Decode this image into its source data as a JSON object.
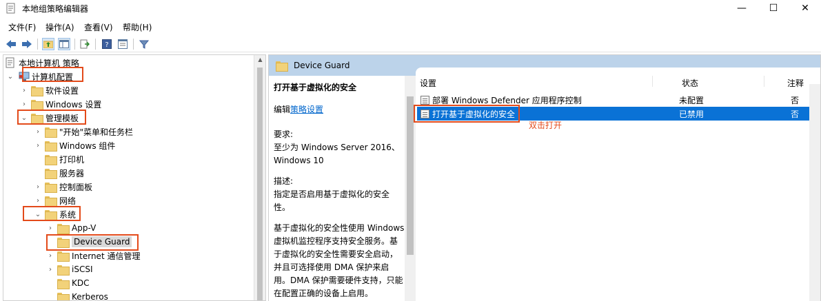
{
  "window": {
    "title": "本地组策略编辑器",
    "min": "—",
    "max": "☐",
    "close": "✕"
  },
  "menu": [
    "文件(F)",
    "操作(A)",
    "查看(V)",
    "帮助(H)"
  ],
  "toolbar_icons": [
    "back-icon",
    "forward-icon",
    "up-folder-icon",
    "show-hide-tree-icon",
    "export-list-icon",
    "help-icon",
    "properties-icon",
    "filter-icon"
  ],
  "tree": {
    "root": "本地计算机 策略",
    "computer_config": "计算机配置",
    "software": "软件设置",
    "windows_settings": "Windows 设置",
    "admin_templates": "管理模板",
    "start_menu": "\"开始\"菜单和任务栏",
    "windows_components": "Windows 组件",
    "printers": "打印机",
    "server": "服务器",
    "control_panel": "控制面板",
    "network": "网络",
    "system": "系统",
    "app_v": "App-V",
    "device_guard": "Device Guard",
    "internet_comm": "Internet 通信管理",
    "iscsi": "iSCSI",
    "kdc": "KDC",
    "kerberos": "Kerberos"
  },
  "right_header": "Device Guard",
  "description": {
    "title": "打开基于虚拟化的安全",
    "edit_prefix": "编辑",
    "edit_link": "策略设置",
    "req_label": "要求:",
    "req_text": "至少为 Windows Server 2016、Windows 10",
    "desc_label": "描述:",
    "desc_text": "指定是否启用基于虚拟化的安全性。",
    "body_text": "基于虚拟化的安全性使用 Windows 虚拟机监控程序支持安全服务。基于虚拟化的安全性需要安全启动，并且可选择使用 DMA 保护来启用。DMA 保护需要硬件支持，只能在配置正确的设备上启用。"
  },
  "list": {
    "headers": {
      "setting": "设置",
      "state": "状态",
      "comment": "注释"
    },
    "rows": [
      {
        "setting": "部署 Windows Defender 应用程序控制",
        "state": "未配置",
        "comment": "否",
        "selected": false
      },
      {
        "setting": "打开基于虚拟化的安全",
        "state": "已禁用",
        "comment": "否",
        "selected": true
      }
    ]
  },
  "annotation": "双击打开",
  "colors": {
    "highlight": "#e34a1a",
    "selection": "#0a72d6",
    "header": "#bcd3ea"
  }
}
